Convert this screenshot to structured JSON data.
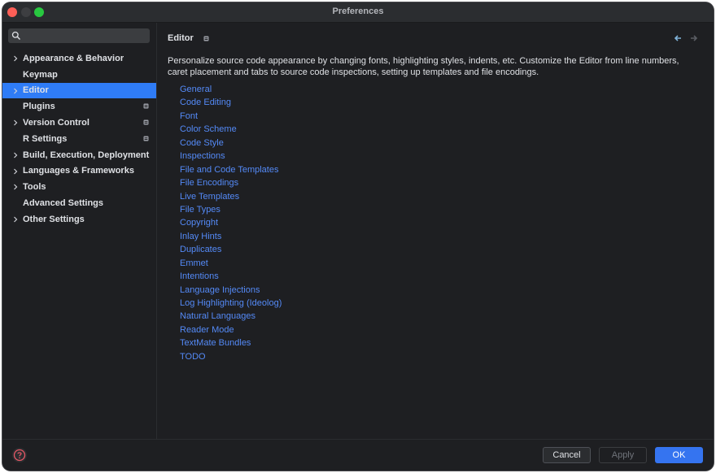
{
  "window": {
    "title": "Preferences"
  },
  "search": {
    "placeholder": ""
  },
  "sidebar": {
    "items": [
      {
        "label": "Appearance & Behavior",
        "expandable": true,
        "badge": false,
        "selected": false
      },
      {
        "label": "Keymap",
        "expandable": false,
        "badge": false,
        "selected": false
      },
      {
        "label": "Editor",
        "expandable": true,
        "badge": false,
        "selected": true
      },
      {
        "label": "Plugins",
        "expandable": false,
        "badge": true,
        "selected": false
      },
      {
        "label": "Version Control",
        "expandable": true,
        "badge": true,
        "selected": false
      },
      {
        "label": "R Settings",
        "expandable": false,
        "badge": true,
        "selected": false
      },
      {
        "label": "Build, Execution, Deployment",
        "expandable": true,
        "badge": false,
        "selected": false
      },
      {
        "label": "Languages & Frameworks",
        "expandable": true,
        "badge": false,
        "selected": false
      },
      {
        "label": "Tools",
        "expandable": true,
        "badge": false,
        "selected": false
      },
      {
        "label": "Advanced Settings",
        "expandable": false,
        "badge": false,
        "selected": false
      },
      {
        "label": "Other Settings",
        "expandable": true,
        "badge": false,
        "selected": false
      }
    ]
  },
  "main": {
    "title": "Editor",
    "description": "Personalize source code appearance by changing fonts, highlighting styles, indents, etc. Customize the Editor from line numbers, caret placement and tabs to source code inspections, setting up templates and file encodings.",
    "links": [
      "General",
      "Code Editing",
      "Font",
      "Color Scheme",
      "Code Style",
      "Inspections",
      "File and Code Templates",
      "File Encodings",
      "Live Templates",
      "File Types",
      "Copyright",
      "Inlay Hints",
      "Duplicates",
      "Emmet",
      "Intentions",
      "Language Injections",
      "Log Highlighting (Ideolog)",
      "Natural Languages",
      "Reader Mode",
      "TextMate Bundles",
      "TODO"
    ]
  },
  "footer": {
    "cancel_label": "Cancel",
    "apply_label": "Apply",
    "ok_label": "OK"
  },
  "icons": {
    "search": "search-icon",
    "chevron": "chevron-right-icon",
    "badge": "project-level-icon",
    "back": "arrow-left-icon",
    "forward": "arrow-right-icon",
    "help": "help-icon"
  },
  "colors": {
    "selection": "#2f7cf6",
    "link": "#548af7",
    "ok_button": "#3574f0",
    "background": "#1e1f22"
  }
}
